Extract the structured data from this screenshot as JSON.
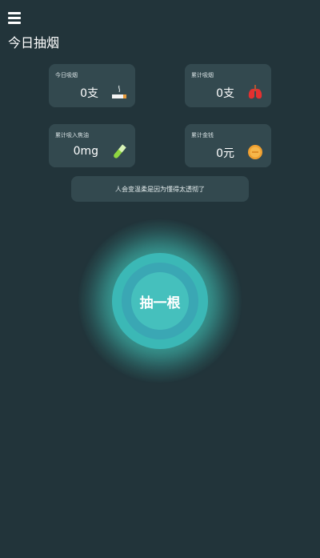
{
  "header": {
    "title": "今日抽烟"
  },
  "stats": [
    {
      "label": "今日吸烟",
      "value": "0支",
      "icon": "cigarette-icon"
    },
    {
      "label": "累计吸烟",
      "value": "0支",
      "icon": "lungs-icon"
    },
    {
      "label": "累计吸入焦油",
      "value": "0mg",
      "icon": "test-tube-icon"
    },
    {
      "label": "累计金钱",
      "value": "0元",
      "icon": "coin-icon"
    }
  ],
  "quote": "人会变温柔是因为懂得太透彻了",
  "action": {
    "label": "抽一根"
  },
  "colors": {
    "background": "#22343a",
    "card": "#33494f",
    "accent": "#45c0bd"
  }
}
